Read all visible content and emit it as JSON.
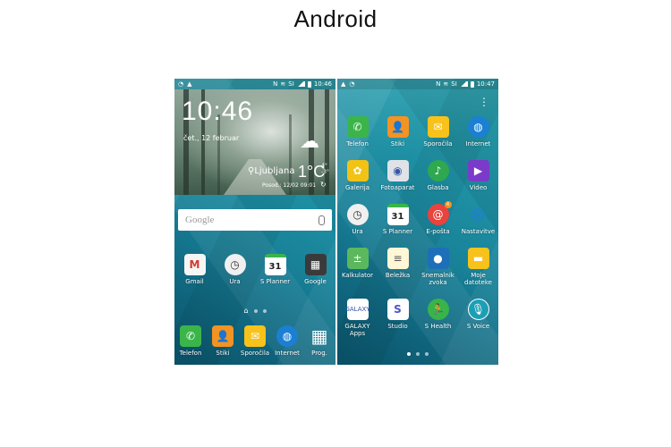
{
  "title": "Android",
  "home": {
    "status": {
      "time": "10:46",
      "carrier": "SI"
    },
    "widget": {
      "time": "10:46",
      "date": "čet., 12 februar",
      "location": "Ljubljana",
      "temp": "1°C",
      "hi": "4°",
      "lo": "-3°",
      "updated": "Posod.: 12/02 09:01"
    },
    "search": {
      "logo": "Google"
    },
    "row1": [
      {
        "label": "Gmail",
        "icon": "gmail-icon",
        "glyph": "M"
      },
      {
        "label": "Ura",
        "icon": "clock-icon",
        "glyph": "◷"
      },
      {
        "label": "S Planner",
        "icon": "calendar-icon",
        "glyph": "31"
      },
      {
        "label": "Google",
        "icon": "google-folder-icon",
        "glyph": "▦"
      }
    ],
    "dock": [
      {
        "label": "Telefon",
        "icon": "phone-icon",
        "glyph": "✆"
      },
      {
        "label": "Stiki",
        "icon": "contacts-icon",
        "glyph": "👤"
      },
      {
        "label": "Sporočila",
        "icon": "messages-icon",
        "glyph": "✉"
      },
      {
        "label": "Internet",
        "icon": "globe-icon",
        "glyph": "◍"
      },
      {
        "label": "Prog.",
        "icon": "apps-grid-icon",
        "glyph": "▦"
      }
    ]
  },
  "apps": {
    "status": {
      "time": "10:47",
      "carrier": "SI"
    },
    "grid": [
      {
        "label": "Telefon",
        "icon": "phone-icon",
        "glyph": "✆",
        "cls": "c-green"
      },
      {
        "label": "Stiki",
        "icon": "contacts-icon",
        "glyph": "👤",
        "cls": "c-orange"
      },
      {
        "label": "Sporočila",
        "icon": "messages-icon",
        "glyph": "✉",
        "cls": "c-yellow"
      },
      {
        "label": "Internet",
        "icon": "globe-icon",
        "glyph": "◍",
        "cls": "c-blue"
      },
      {
        "label": "Galerija",
        "icon": "gallery-icon",
        "glyph": "✿",
        "cls": "c-gallery"
      },
      {
        "label": "Fotoaparat",
        "icon": "camera-icon",
        "glyph": "◉",
        "cls": "c-camera"
      },
      {
        "label": "Glasba",
        "icon": "music-icon",
        "glyph": "♪",
        "cls": "c-music"
      },
      {
        "label": "Video",
        "icon": "video-icon",
        "glyph": "▶",
        "cls": "c-video"
      },
      {
        "label": "Ura",
        "icon": "clock-icon",
        "glyph": "◷",
        "cls": "c-clock"
      },
      {
        "label": "S Planner",
        "icon": "calendar-icon",
        "glyph": "31",
        "cls": "c-cal"
      },
      {
        "label": "E-pošta",
        "icon": "email-icon",
        "glyph": "@",
        "cls": "c-email",
        "badge": "4"
      },
      {
        "label": "Nastavitve",
        "icon": "settings-icon",
        "glyph": "⚙",
        "cls": "c-settings"
      },
      {
        "label": "Kalkulator",
        "icon": "calculator-icon",
        "glyph": "±",
        "cls": "c-calc"
      },
      {
        "label": "Beležka",
        "icon": "memo-icon",
        "glyph": "≡",
        "cls": "c-memo"
      },
      {
        "label": "Snemalnik zvoka",
        "icon": "voice-recorder-icon",
        "glyph": "●",
        "cls": "c-rec"
      },
      {
        "label": "Moje datoteke",
        "icon": "folder-icon",
        "glyph": "▬",
        "cls": "c-files"
      },
      {
        "label": "GALAXY Apps",
        "icon": "galaxy-apps-icon",
        "glyph": "GALAXY",
        "cls": "c-galaxy"
      },
      {
        "label": "Studio",
        "icon": "studio-icon",
        "glyph": "S",
        "cls": "c-studio"
      },
      {
        "label": "S Health",
        "icon": "health-icon",
        "glyph": "🏃",
        "cls": "c-health"
      },
      {
        "label": "S Voice",
        "icon": "microphone-icon",
        "glyph": "🎙",
        "cls": "c-voice"
      }
    ]
  }
}
